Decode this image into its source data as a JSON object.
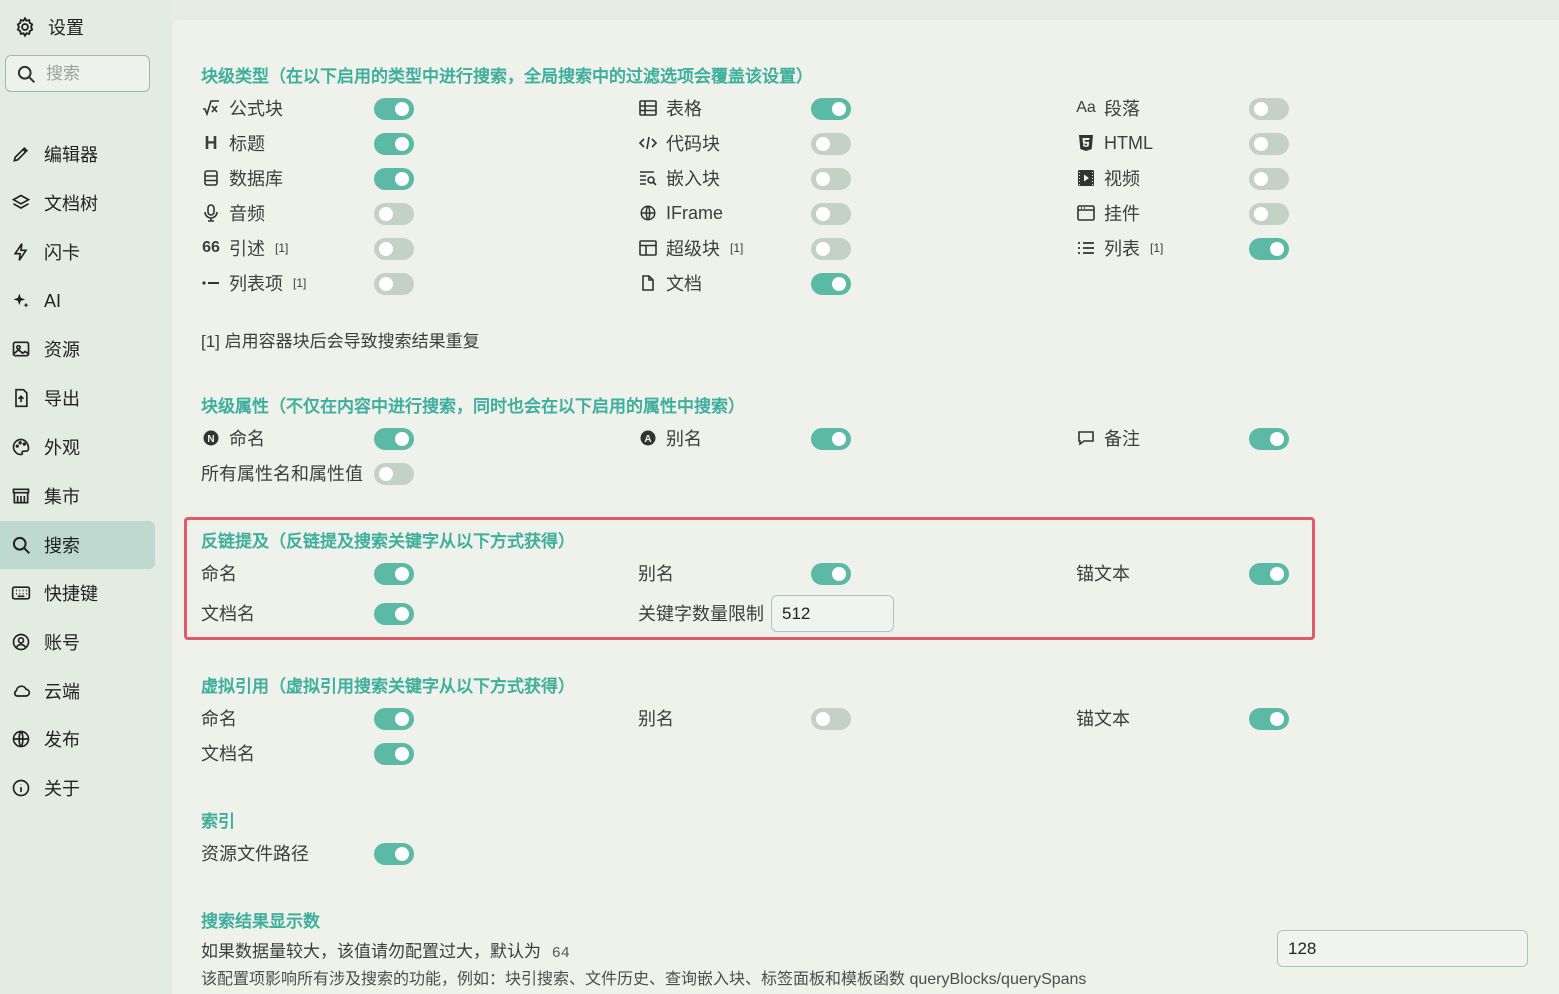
{
  "app": {
    "title": "设置"
  },
  "search": {
    "placeholder": "搜索"
  },
  "sidebar": {
    "items": [
      {
        "label": "编辑器",
        "icon": "pencil-icon",
        "active": false
      },
      {
        "label": "文档树",
        "icon": "layers-icon",
        "active": false
      },
      {
        "label": "闪卡",
        "icon": "bolt-icon",
        "active": false
      },
      {
        "label": "AI",
        "icon": "sparkle-icon",
        "active": false
      },
      {
        "label": "资源",
        "icon": "image-icon",
        "active": false
      },
      {
        "label": "导出",
        "icon": "export-icon",
        "active": false
      },
      {
        "label": "外观",
        "icon": "palette-icon",
        "active": false
      },
      {
        "label": "集市",
        "icon": "store-icon",
        "active": false
      },
      {
        "label": "搜索",
        "icon": "search-icon",
        "active": true
      },
      {
        "label": "快捷键",
        "icon": "keyboard-icon",
        "active": false
      },
      {
        "label": "账号",
        "icon": "account-icon",
        "active": false
      },
      {
        "label": "云端",
        "icon": "cloud-icon",
        "active": false
      },
      {
        "label": "发布",
        "icon": "globe-icon",
        "active": false
      },
      {
        "label": "关于",
        "icon": "info-icon",
        "active": false
      }
    ]
  },
  "block_types": {
    "title": "块级类型（在以下启用的类型中进行搜索，全局搜索中的过滤选项会覆盖该设置）",
    "items": [
      {
        "label": "公式块",
        "icon": "math-icon",
        "on": true,
        "note": ""
      },
      {
        "label": "表格",
        "icon": "table-icon",
        "on": true,
        "note": ""
      },
      {
        "label": "段落",
        "icon": "paragraph-icon",
        "on": false,
        "note": ""
      },
      {
        "label": "标题",
        "icon": "heading-icon",
        "on": true,
        "note": ""
      },
      {
        "label": "代码块",
        "icon": "code-icon",
        "on": false,
        "note": ""
      },
      {
        "label": "HTML",
        "icon": "html-icon",
        "on": false,
        "note": ""
      },
      {
        "label": "数据库",
        "icon": "database-icon",
        "on": true,
        "note": ""
      },
      {
        "label": "嵌入块",
        "icon": "embed-icon",
        "on": false,
        "note": ""
      },
      {
        "label": "视频",
        "icon": "video-icon",
        "on": false,
        "note": ""
      },
      {
        "label": "音频",
        "icon": "microphone-icon",
        "on": false,
        "note": ""
      },
      {
        "label": "IFrame",
        "icon": "globe-icon",
        "on": false,
        "note": ""
      },
      {
        "label": "挂件",
        "icon": "widget-icon",
        "on": false,
        "note": ""
      },
      {
        "label": "引述",
        "icon": "quote-icon",
        "on": false,
        "note": "[1]"
      },
      {
        "label": "超级块",
        "icon": "superblock-icon",
        "on": false,
        "note": "[1]"
      },
      {
        "label": "列表",
        "icon": "list-icon",
        "on": true,
        "note": "[1]"
      },
      {
        "label": "列表项",
        "icon": "list-item-icon",
        "on": false,
        "note": "[1]"
      },
      {
        "label": "文档",
        "icon": "file-icon",
        "on": true,
        "note": ""
      }
    ],
    "footnote": "[1] 启用容器块后会导致搜索结果重复"
  },
  "block_attrs": {
    "title": "块级属性（不仅在内容中进行搜索，同时也会在以下启用的属性中搜索）",
    "items": [
      {
        "label": "命名",
        "icon": "name-badge-icon",
        "on": true
      },
      {
        "label": "别名",
        "icon": "alias-badge-icon",
        "on": true
      },
      {
        "label": "备注",
        "icon": "comment-icon",
        "on": true
      },
      {
        "label": "所有属性名和属性值",
        "icon": "",
        "on": false
      }
    ]
  },
  "backlink": {
    "title": "反链提及（反链提及搜索关键字从以下方式获得）",
    "items": [
      {
        "label": "命名",
        "on": true
      },
      {
        "label": "别名",
        "on": true
      },
      {
        "label": "锚文本",
        "on": true
      },
      {
        "label": "文档名",
        "on": true
      }
    ],
    "keyword_limit_label": "关键字数量限制",
    "keyword_limit_value": "512"
  },
  "virtual_ref": {
    "title": "虚拟引用（虚拟引用搜索关键字从以下方式获得）",
    "items": [
      {
        "label": "命名",
        "on": true
      },
      {
        "label": "别名",
        "on": false
      },
      {
        "label": "锚文本",
        "on": true
      },
      {
        "label": "文档名",
        "on": true
      }
    ]
  },
  "index": {
    "title": "索引",
    "items": [
      {
        "label": "资源文件路径",
        "on": true
      }
    ]
  },
  "results_limit": {
    "title": "搜索结果显示数",
    "desc": "如果数据量较大，该值请勿配置过大，默认为",
    "default": "64",
    "desc2": "该配置项影响所有涉及搜索的功能，例如：块引搜索、文件历史、查询嵌入块、标签面板和模板函数 queryBlocks/querySpans",
    "value": "128"
  },
  "colors": {
    "accent": "#5cb9a6",
    "heading": "#3fae9c",
    "highlight": "#e05a6a",
    "active_nav": "#bdd9d0"
  }
}
